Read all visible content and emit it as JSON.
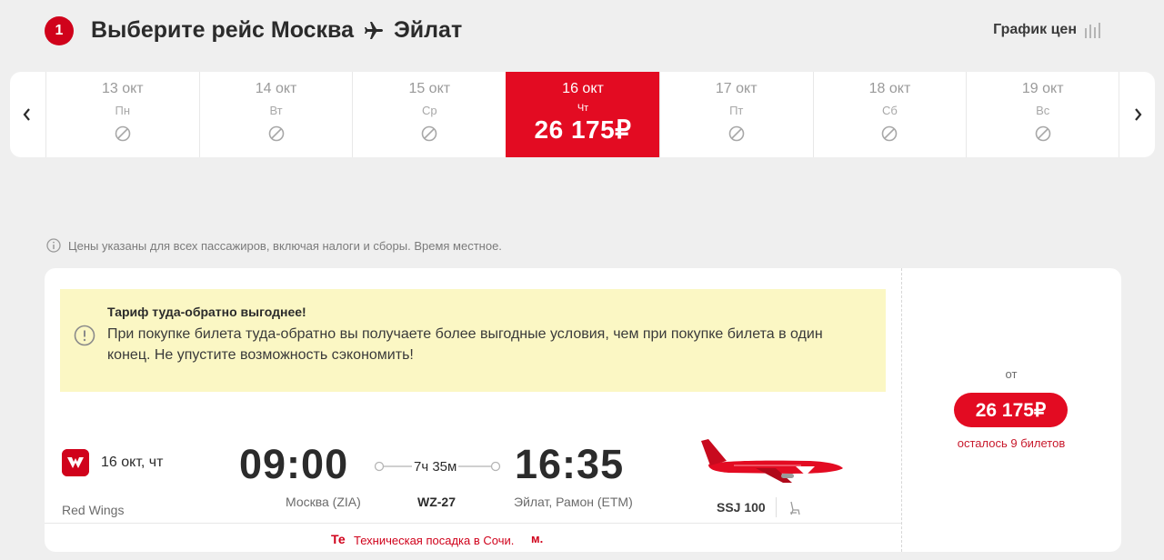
{
  "header": {
    "step": "1",
    "title_prefix": "Выберите рейс Москва",
    "title_dest": "Эйлат",
    "price_chart_label": "График цен"
  },
  "date_strip": {
    "days": [
      {
        "date": "13 окт",
        "weekday": "Пн",
        "available": false
      },
      {
        "date": "14 окт",
        "weekday": "Вт",
        "available": false
      },
      {
        "date": "15 окт",
        "weekday": "Ср",
        "available": false
      },
      {
        "date": "16 окт",
        "weekday": "Чт",
        "available": true,
        "price": "26 175₽",
        "selected": true
      },
      {
        "date": "17 окт",
        "weekday": "Пт",
        "available": false
      },
      {
        "date": "18 окт",
        "weekday": "Сб",
        "available": false
      },
      {
        "date": "19 окт",
        "weekday": "Вс",
        "available": false
      }
    ]
  },
  "info": {
    "text": "Цены указаны для всех пассажиров, включая налоги и сборы. Время местное."
  },
  "promo": {
    "title": "Тариф туда-обратно выгоднее!",
    "text": "При покупке билета туда-обратно вы получаете более выгодные условия, чем при покупке билета в один конец. Не упустите возможность сэкономить!"
  },
  "flight": {
    "date": "16 окт, чт",
    "airline": "Red Wings",
    "departure_time": "09:00",
    "arrival_time": "16:35",
    "duration": "7ч 35м",
    "departure_airport": "Москва (ZIA)",
    "arrival_airport": "Эйлат, Рамон (ETM)",
    "flight_number": "WZ-27",
    "aircraft": "SSJ 100",
    "notice_prefix": "Те",
    "notice_text": "Техническая посадка в Сочи.",
    "notice_suffix": "м."
  },
  "price_box": {
    "from_label": "от",
    "price": "26 175₽",
    "seats_left": "осталось 9 билетов"
  },
  "colors": {
    "brand_red": "#e30b22",
    "promo_bg": "#fbf7c4",
    "page_bg": "#efefef"
  }
}
